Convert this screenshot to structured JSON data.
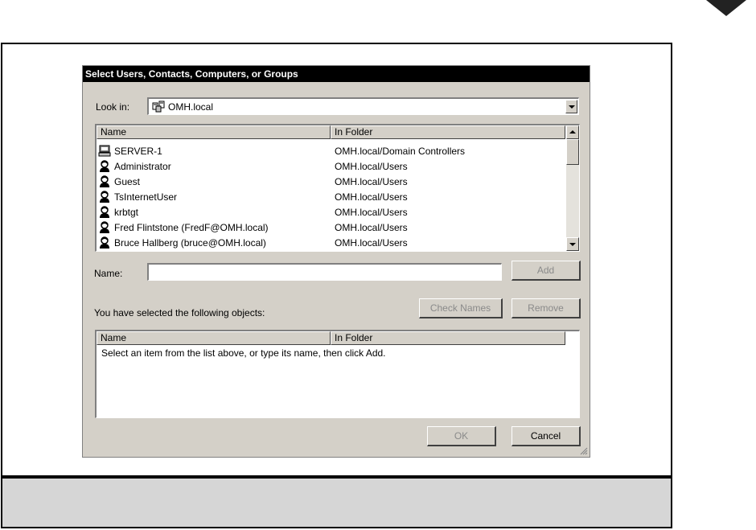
{
  "dialog": {
    "title": "Select Users, Contacts, Computers, or Groups",
    "look_in_label": "Look in:",
    "look_in_value": "OMH.local",
    "columns": {
      "name": "Name",
      "folder": "In Folder"
    },
    "objects": [
      {
        "icon": "computer-icon",
        "name": "SERVER-1",
        "folder": "OMH.local/Domain Controllers"
      },
      {
        "icon": "user-icon",
        "name": "Administrator",
        "folder": "OMH.local/Users"
      },
      {
        "icon": "user-icon",
        "name": "Guest",
        "folder": "OMH.local/Users"
      },
      {
        "icon": "user-icon",
        "name": "TsInternetUser",
        "folder": "OMH.local/Users"
      },
      {
        "icon": "user-icon",
        "name": "krbtgt",
        "folder": "OMH.local/Users"
      },
      {
        "icon": "user-icon",
        "name": "Fred Flintstone (FredF@OMH.local)",
        "folder": "OMH.local/Users"
      },
      {
        "icon": "user-icon",
        "name": "Bruce Hallberg (bruce@OMH.local)",
        "folder": "OMH.local/Users"
      }
    ],
    "name_label": "Name:",
    "name_value": "",
    "add_label": "Add",
    "selected_label": "You have selected the following objects:",
    "check_names_label": "Check Names",
    "remove_label": "Remove",
    "selected_columns": {
      "name": "Name",
      "folder": "In Folder"
    },
    "selected_hint": "Select an item from the list above, or type its name, then click Add.",
    "ok_label": "OK",
    "cancel_label": "Cancel"
  }
}
